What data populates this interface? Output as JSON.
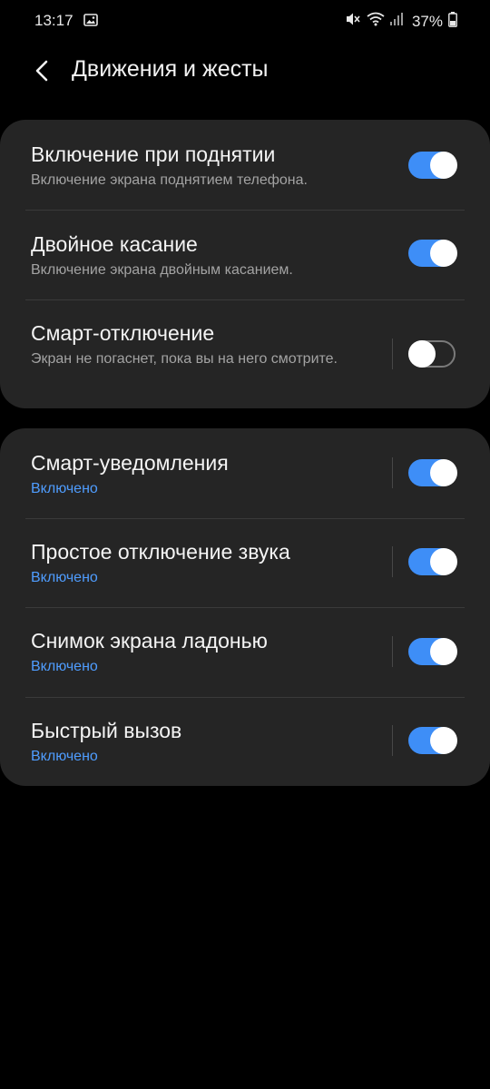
{
  "status_bar": {
    "time": "13:17",
    "battery": "37%",
    "icons": [
      "gallery-icon",
      "mute-icon",
      "wifi-icon",
      "signal-icon",
      "battery-icon"
    ]
  },
  "header": {
    "title": "Движения и жесты",
    "back_icon": "back-arrow-icon"
  },
  "colors": {
    "toggle_on": "#3e8ef7",
    "status_on_text": "#4f9dff",
    "card_bg": "#252525"
  },
  "settings_group_1": [
    {
      "label": "Включение при поднятии",
      "description": "Включение экрана поднятием телефона.",
      "enabled": true
    },
    {
      "label": "Двойное касание",
      "description": "Включение экрана двойным касанием.",
      "enabled": true
    },
    {
      "label": "Смарт-отключение",
      "description": "Экран не погаснет, пока вы на него смотрите.",
      "enabled": false
    }
  ],
  "settings_group_2": [
    {
      "label": "Смарт-уведомления",
      "status": "Включено",
      "enabled": true
    },
    {
      "label": "Простое отключение звука",
      "status": "Включено",
      "enabled": true
    },
    {
      "label": "Снимок экрана ладонью",
      "status": "Включено",
      "enabled": true
    },
    {
      "label": "Быстрый вызов",
      "status": "Включено",
      "enabled": true
    }
  ]
}
